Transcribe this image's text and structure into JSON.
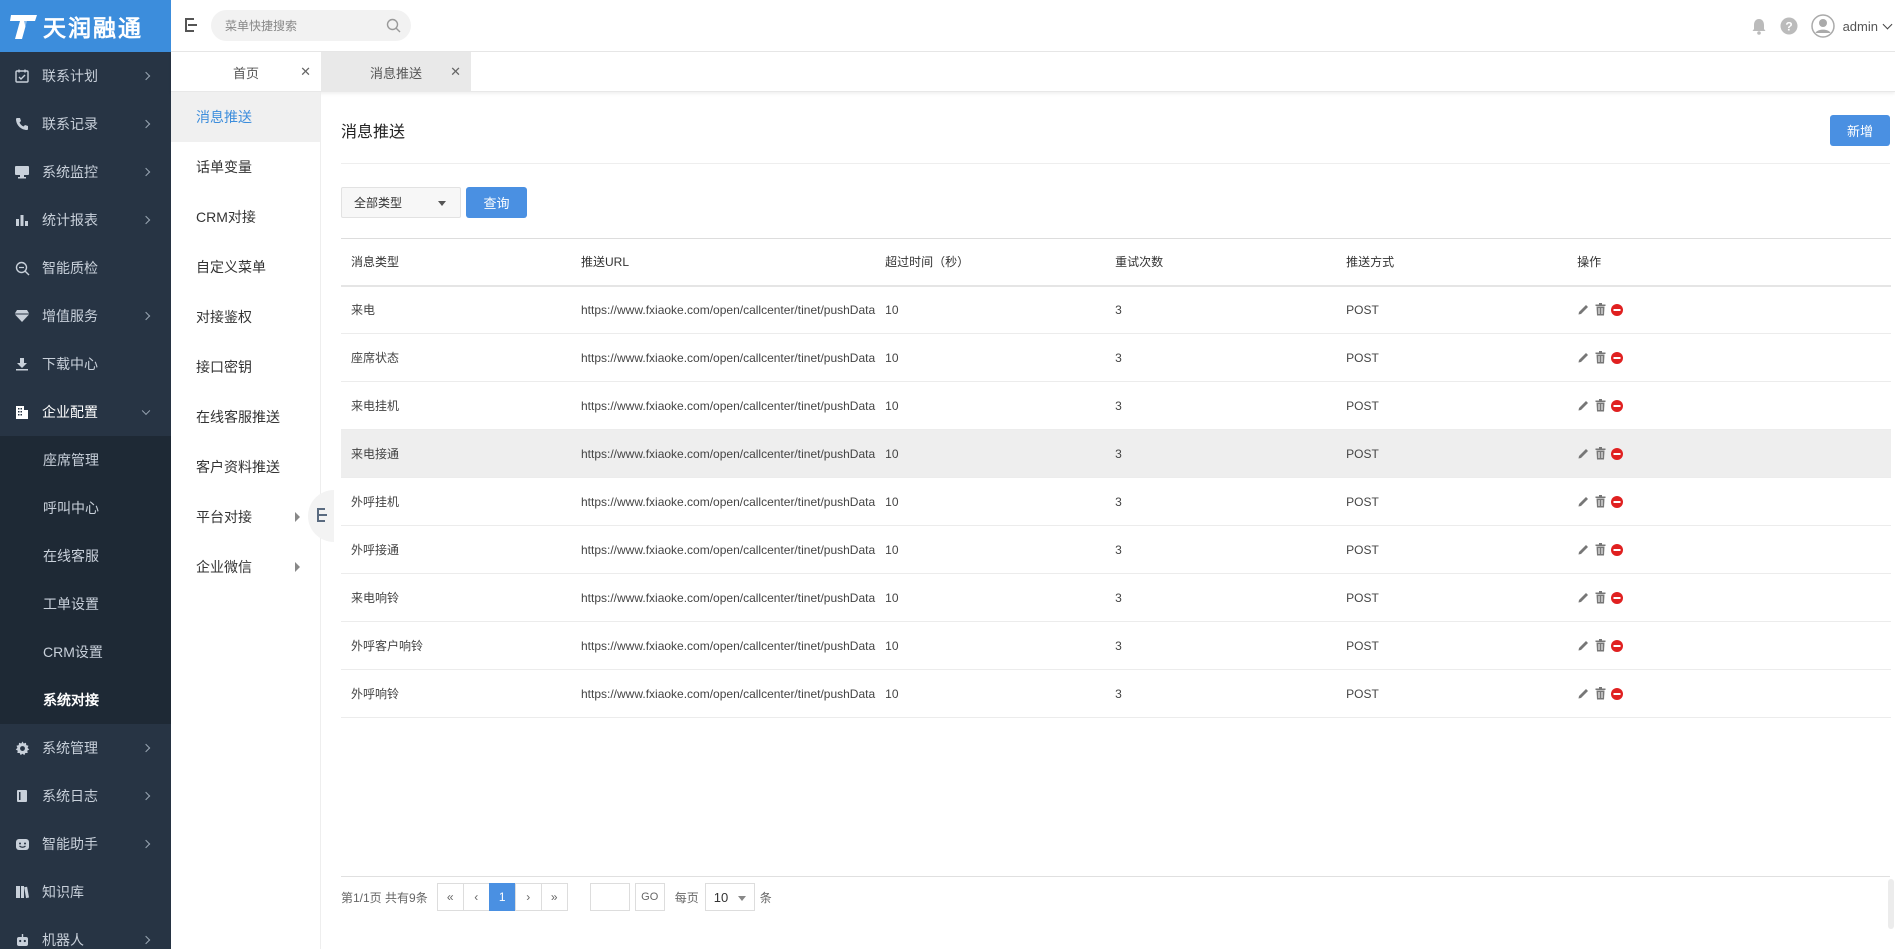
{
  "brand": {
    "name": "天润融通",
    "color": "#3c8ddc"
  },
  "colors": {
    "sidebar_bg": "#273444",
    "accent": "#4a90e2",
    "danger": "#e02020"
  },
  "sidebar": {
    "items": [
      {
        "label": "联系计划",
        "icon": "calendar-check-icon"
      },
      {
        "label": "联系记录",
        "icon": "phone-icon"
      },
      {
        "label": "系统监控",
        "icon": "monitor-icon"
      },
      {
        "label": "统计报表",
        "icon": "bar-chart-icon"
      },
      {
        "label": "智能质检",
        "icon": "search-zoom-icon"
      },
      {
        "label": "增值服务",
        "icon": "diamond-icon"
      },
      {
        "label": "下载中心",
        "icon": "download-icon"
      },
      {
        "label": "企业配置",
        "icon": "building-icon"
      }
    ],
    "sub_items": [
      "座席管理",
      "呼叫中心",
      "在线客服",
      "工单设置",
      "CRM设置",
      "系统对接"
    ],
    "items_after": [
      {
        "label": "系统管理",
        "icon": "gear-icon"
      },
      {
        "label": "系统日志",
        "icon": "log-book-icon"
      },
      {
        "label": "智能助手",
        "icon": "smile-icon"
      },
      {
        "label": "知识库",
        "icon": "book-icon"
      },
      {
        "label": "机器人",
        "icon": "robot-icon"
      }
    ]
  },
  "header": {
    "search_placeholder": "菜单快捷搜索",
    "user": "admin"
  },
  "tabs": [
    {
      "label": "首页"
    },
    {
      "label": "消息推送"
    }
  ],
  "submenu": [
    "消息推送",
    "话单变量",
    "CRM对接",
    "自定义菜单",
    "对接鉴权",
    "接口密钥",
    "在线客服推送",
    "客户资料推送",
    "平台对接",
    "企业微信"
  ],
  "main": {
    "title": "消息推送",
    "add_label": "新增",
    "filter_value": "全部类型",
    "query_label": "查询"
  },
  "table": {
    "headers": [
      "消息类型",
      "推送URL",
      "超过时间（秒）",
      "重试次数",
      "推送方式",
      "操作"
    ],
    "rows": [
      [
        "来电",
        "https://www.fxiaoke.com/open/callcenter/tinet/pushData",
        "10",
        "3",
        "POST"
      ],
      [
        "座席状态",
        "https://www.fxiaoke.com/open/callcenter/tinet/pushData",
        "10",
        "3",
        "POST"
      ],
      [
        "来电挂机",
        "https://www.fxiaoke.com/open/callcenter/tinet/pushData",
        "10",
        "3",
        "POST"
      ],
      [
        "来电接通",
        "https://www.fxiaoke.com/open/callcenter/tinet/pushData",
        "10",
        "3",
        "POST"
      ],
      [
        "外呼挂机",
        "https://www.fxiaoke.com/open/callcenter/tinet/pushData",
        "10",
        "3",
        "POST"
      ],
      [
        "外呼接通",
        "https://www.fxiaoke.com/open/callcenter/tinet/pushData",
        "10",
        "3",
        "POST"
      ],
      [
        "来电响铃",
        "https://www.fxiaoke.com/open/callcenter/tinet/pushData",
        "10",
        "3",
        "POST"
      ],
      [
        "外呼客户响铃",
        "https://www.fxiaoke.com/open/callcenter/tinet/pushData",
        "10",
        "3",
        "POST"
      ],
      [
        "外呼响铃",
        "https://www.fxiaoke.com/open/callcenter/tinet/pushData",
        "10",
        "3",
        "POST"
      ]
    ]
  },
  "pager": {
    "info": "第1/1页 共有9条",
    "first": "«",
    "prev": "‹",
    "current": "1",
    "next": "›",
    "last": "»",
    "go": "GO",
    "per_page": "每页",
    "size": "10",
    "unit": "条"
  }
}
